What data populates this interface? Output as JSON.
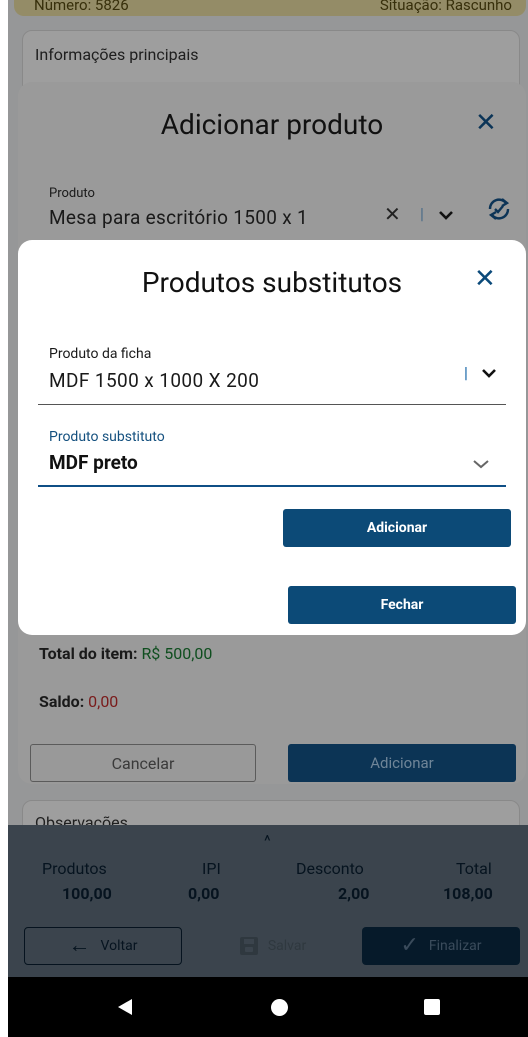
{
  "header": {
    "numero": "Número: 5826",
    "situacao": "Situação: Rascunho"
  },
  "main": {
    "card_title": "Informações principais",
    "observacoes_title": "Observações"
  },
  "dialog_add_product": {
    "title": "Adicionar produto",
    "product_label": "Produto",
    "product_value": "Mesa para escritório 1500 x 1",
    "total_label": "Total do item:",
    "total_value": "R$ 500,00",
    "saldo_label": "Saldo:",
    "saldo_value": "0,00",
    "cancel_label": "Cancelar",
    "add_label": "Adicionar"
  },
  "dialog_substitutes": {
    "title": "Produtos substitutos",
    "ficha_label": "Produto da ficha",
    "ficha_value": "MDF 1500 x 1000 X 200",
    "substituto_label": "Produto substituto",
    "substituto_value": "MDF preto",
    "add_label": "Adicionar",
    "close_label": "Fechar"
  },
  "summary": {
    "produtos_label": "Produtos",
    "produtos_value": "100,00",
    "ipi_label": "IPI",
    "ipi_value": "0,00",
    "desconto_label": "Desconto",
    "desconto_value": "2,00",
    "total_label": "Total",
    "total_value": "108,00"
  },
  "footer_actions": {
    "voltar_label": "Voltar",
    "salvar_label": "Salvar",
    "finalizar_label": "Finalizar"
  },
  "colors": {
    "primary": "#0c4a77",
    "red_value": "#c62828",
    "green_value": "#1e8e3e"
  }
}
